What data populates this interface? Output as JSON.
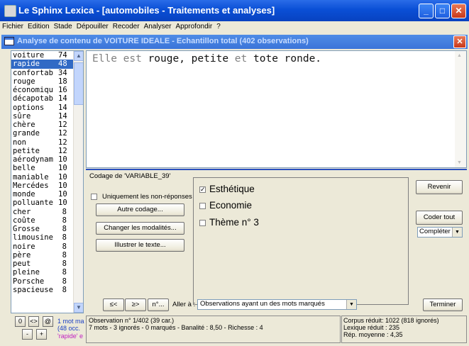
{
  "app": {
    "title": "Le Sphinx Lexica - [automobiles - Traitements et analyses]",
    "window_buttons": {
      "minimize": "_",
      "maximize": "□",
      "close": "✕"
    }
  },
  "menu": [
    "Fichier",
    "Edition",
    "Stade",
    "Dépouiller",
    "Recoder",
    "Analyser",
    "Approfondir",
    "?"
  ],
  "child_window": {
    "title": "Analyse de contenu de VOITURE IDEALE - Echantillon total (402 observations)",
    "close": "✕"
  },
  "word_list": [
    {
      "word": "voiture",
      "count": "74"
    },
    {
      "word": "rapide",
      "count": "48",
      "selected": true
    },
    {
      "word": "confortab",
      "count": "34"
    },
    {
      "word": "rouge",
      "count": "18"
    },
    {
      "word": "économiqu",
      "count": "16"
    },
    {
      "word": "décapotab",
      "count": "14"
    },
    {
      "word": "options",
      "count": "14"
    },
    {
      "word": "sûre",
      "count": "14"
    },
    {
      "word": "chère",
      "count": "12"
    },
    {
      "word": "grande",
      "count": "12"
    },
    {
      "word": "non",
      "count": "12"
    },
    {
      "word": "petite",
      "count": "12"
    },
    {
      "word": "aérodynam",
      "count": "10"
    },
    {
      "word": "belle",
      "count": "10"
    },
    {
      "word": "maniable",
      "count": "10"
    },
    {
      "word": "Mercédes",
      "count": "10"
    },
    {
      "word": "monde",
      "count": "10"
    },
    {
      "word": "polluante",
      "count": "10"
    },
    {
      "word": "cher",
      "count": "8"
    },
    {
      "word": "coûte",
      "count": "8"
    },
    {
      "word": "Grosse",
      "count": "8"
    },
    {
      "word": "limousine",
      "count": "8"
    },
    {
      "word": "noire",
      "count": "8"
    },
    {
      "word": "père",
      "count": "8"
    },
    {
      "word": "peut",
      "count": "8"
    },
    {
      "word": "pleine",
      "count": "8"
    },
    {
      "word": "Porsche",
      "count": "8"
    },
    {
      "word": "spacieuse",
      "count": "8"
    }
  ],
  "text_panel": {
    "sentence": [
      {
        "t": "Elle est ",
        "gray": true
      },
      {
        "t": "rouge, petite ",
        "gray": false
      },
      {
        "t": "et ",
        "gray": true
      },
      {
        "t": "tote ronde.",
        "gray": false
      }
    ]
  },
  "coding": {
    "heading": "Codage de 'VARIABLE_39'",
    "only_nonresponses": "Uniquement les non-réponses",
    "btn_other": "Autre codage...",
    "btn_change": "Changer les modalités...",
    "btn_illustrate": "Illustrer le texte...",
    "themes": [
      {
        "label": "Esthétique",
        "checked": true
      },
      {
        "label": "Economie",
        "checked": false
      },
      {
        "label": "Thème n° 3",
        "checked": false
      }
    ],
    "btn_back": "Revenir",
    "btn_code_all": "Coder tout",
    "complete_select": "Compléter"
  },
  "nav": {
    "prev": "≤<",
    "next": "≥>",
    "goto": "n°...",
    "goto_label": "Aller à :",
    "goto_select": "Observations ayant un des mots marqués",
    "finish": "Terminer"
  },
  "left_controls": {
    "b1": "0",
    "b2": "<>",
    "b3": "@",
    "b4": "-",
    "b5": "+",
    "info1": "1 mot ma",
    "info2": "(48 occ.",
    "info3": "'rapide' e"
  },
  "status": {
    "obs_line1": "Observation n° 1/402 (39 car.)",
    "obs_line2": "7 mots - 3 ignorés - 0 marqués - Banalité : 8,50 - Richesse : 4",
    "corpus1": "Corpus réduit: 1022 (818 ignorés)",
    "corpus2": "Lexique réduit : 235",
    "corpus3": "Rép. moyenne : 4,35"
  }
}
